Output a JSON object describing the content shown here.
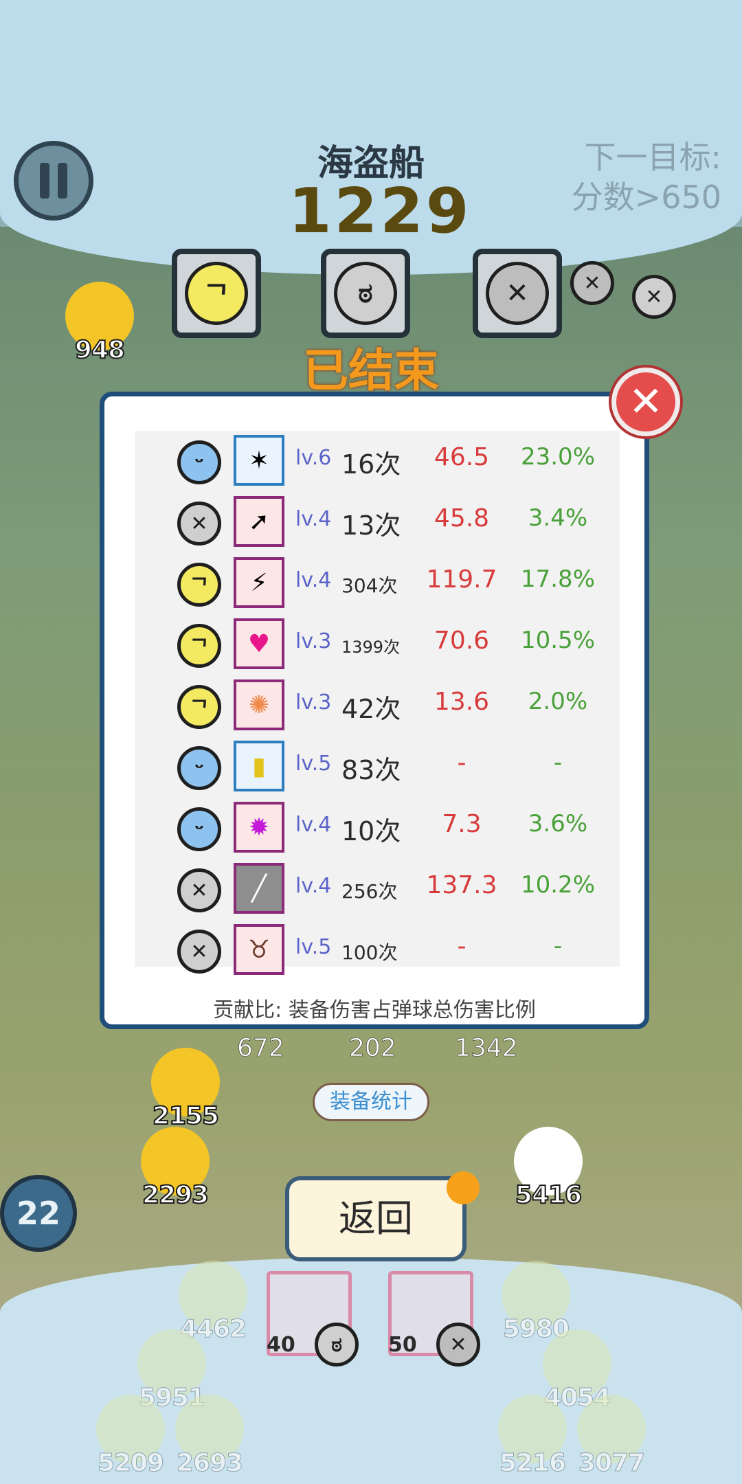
{
  "hud": {
    "level_name": "海盗船",
    "score": "1229",
    "next_target_label": "下一目标:",
    "next_target_value": "分数>650",
    "water_count": "22"
  },
  "banner": {
    "text": "已结束"
  },
  "background_chicks": [
    {
      "num": "948"
    },
    {
      "num": "2155"
    },
    {
      "num": "2293"
    },
    {
      "num": "5416"
    },
    {
      "num": "4462"
    },
    {
      "num": "5980"
    },
    {
      "num": "5951"
    },
    {
      "num": "4054"
    },
    {
      "num": "5209"
    },
    {
      "num": "2693"
    },
    {
      "num": "5216"
    },
    {
      "num": "3077"
    }
  ],
  "stats_popup": {
    "rows": [
      {
        "face": "blue",
        "icon": "claw-slash-icon",
        "level": "lv.6",
        "count": "16次",
        "damage": "46.5",
        "ratio": "23.0%"
      },
      {
        "face": "grey",
        "icon": "rocket-icon",
        "level": "lv.4",
        "count": "13次",
        "damage": "45.8",
        "ratio": "3.4%"
      },
      {
        "face": "yellow",
        "icon": "lightning-icon",
        "level": "lv.4",
        "count": "304次",
        "damage": "119.7",
        "ratio": "17.8%"
      },
      {
        "face": "yellow",
        "icon": "heart-icon",
        "level": "lv.3",
        "count": "1399次",
        "damage": "70.6",
        "ratio": "10.5%"
      },
      {
        "face": "yellow",
        "icon": "explosion-icon",
        "level": "lv.3",
        "count": "42次",
        "damage": "13.6",
        "ratio": "2.0%"
      },
      {
        "face": "blue",
        "icon": "battery-icon",
        "level": "lv.5",
        "count": "83次",
        "damage": "-",
        "ratio": "-"
      },
      {
        "face": "blue",
        "icon": "purple-blast-icon",
        "level": "lv.4",
        "count": "10次",
        "damage": "7.3",
        "ratio": "3.6%"
      },
      {
        "face": "grey",
        "icon": "blade-streak-icon",
        "level": "lv.4",
        "count": "256次",
        "damage": "137.3",
        "ratio": "10.2%"
      },
      {
        "face": "grey",
        "icon": "cow-icon",
        "level": "lv.5",
        "count": "100次",
        "damage": "-",
        "ratio": "-"
      }
    ],
    "note": "贡献比: 装备伤害占弹球总伤害比例"
  },
  "summary_numbers": [
    "672",
    "202",
    "1342"
  ],
  "equip_stats_label": "装备统计",
  "return_label": "返回",
  "equip_slots": [
    {
      "num": "40"
    },
    {
      "num": "50"
    }
  ],
  "colors": {
    "damage": "#d83b3b",
    "ratio": "#4aa13a",
    "level": "#5b63c9",
    "accent": "#1f4e7a"
  }
}
